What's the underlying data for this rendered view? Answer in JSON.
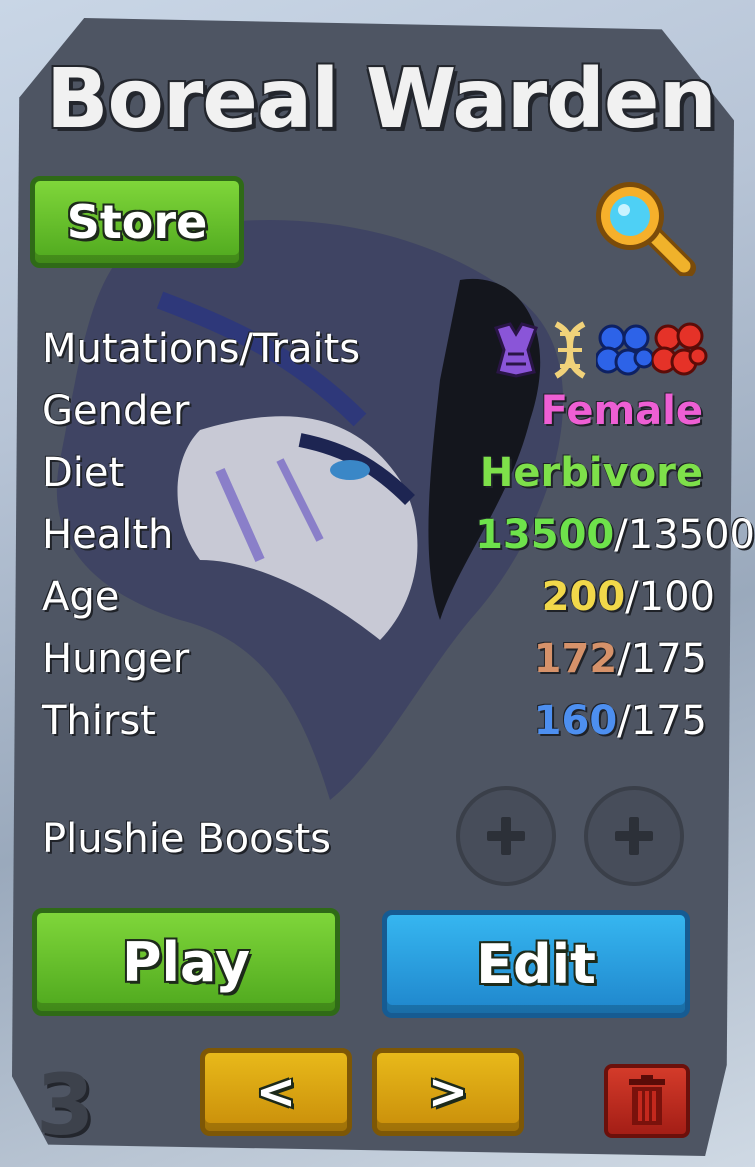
{
  "dino": {
    "name": "Boreal Warden"
  },
  "buttons": {
    "store": "Store",
    "play": "Play",
    "edit": "Edit",
    "prev": "<",
    "next": ">"
  },
  "stats": {
    "mutations_label": "Mutations/Traits",
    "gender_label": "Gender",
    "gender_value": "Female",
    "diet_label": "Diet",
    "diet_value": "Herbivore",
    "health_label": "Health",
    "health_current": "13500",
    "health_max": "/13500",
    "age_label": "Age",
    "age_current": "200",
    "age_max": "/100",
    "hunger_label": "Hunger",
    "hunger_current": "172",
    "hunger_max": "/175",
    "thirst_label": "Thirst",
    "thirst_current": "160",
    "thirst_max": "/175"
  },
  "plushie": {
    "label": "Plushie Boosts"
  },
  "slot_number": "3",
  "icons": [
    "magnifier-icon",
    "purple-trait-icon",
    "dna-icon",
    "blue-cluster-icon",
    "red-cluster-icon",
    "plus-icon",
    "trash-icon"
  ],
  "colors": {
    "gender": "#ee5fd4",
    "diet": "#7ee04a",
    "health": "#6ee24b",
    "age": "#f1d84a",
    "hunger": "#d6926a",
    "thirst": "#4d8ff0"
  }
}
